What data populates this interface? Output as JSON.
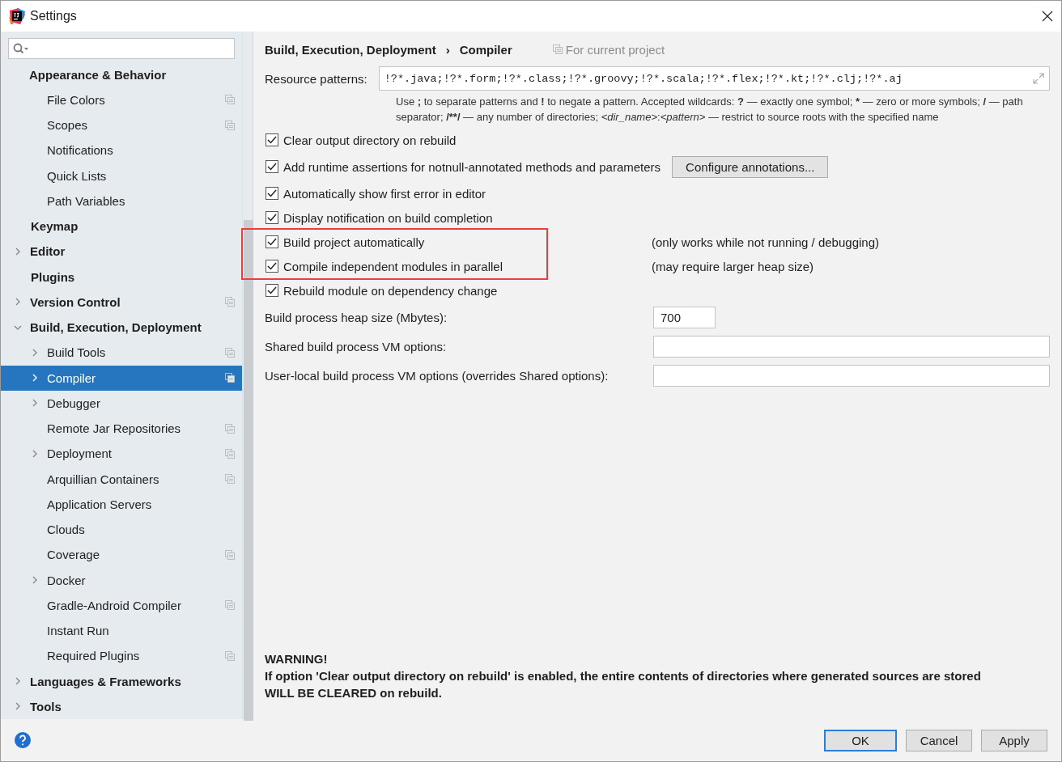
{
  "window": {
    "title": "Settings"
  },
  "sidebar": {
    "items": [
      {
        "label": "Appearance & Behavior",
        "selected": false,
        "project_icon": false,
        "children": [
          {
            "label": "File Colors",
            "selected": false,
            "project_icon": true
          },
          {
            "label": "Scopes",
            "selected": false,
            "project_icon": true
          },
          {
            "label": "Notifications",
            "selected": false,
            "project_icon": false
          },
          {
            "label": "Quick Lists",
            "selected": false,
            "project_icon": false
          },
          {
            "label": "Path Variables",
            "selected": false,
            "project_icon": false
          }
        ]
      },
      {
        "label": "Keymap",
        "selected": false,
        "project_icon": false
      },
      {
        "label": "Editor",
        "selected": false,
        "expanded": false,
        "project_icon": false
      },
      {
        "label": "Plugins",
        "selected": false,
        "project_icon": false
      },
      {
        "label": "Version Control",
        "selected": false,
        "expanded": false,
        "project_icon": true
      },
      {
        "label": "Build, Execution, Deployment",
        "selected": false,
        "expanded": true,
        "project_icon": false,
        "children": [
          {
            "label": "Build Tools",
            "selected": false,
            "expanded": false,
            "project_icon": true
          },
          {
            "label": "Compiler",
            "selected": true,
            "expanded": false,
            "project_icon": true
          },
          {
            "label": "Debugger",
            "selected": false,
            "expanded": false,
            "project_icon": false
          },
          {
            "label": "Remote Jar Repositories",
            "selected": false,
            "project_icon": true
          },
          {
            "label": "Deployment",
            "selected": false,
            "expanded": false,
            "project_icon": true
          },
          {
            "label": "Arquillian Containers",
            "selected": false,
            "project_icon": true
          },
          {
            "label": "Application Servers",
            "selected": false,
            "project_icon": false
          },
          {
            "label": "Clouds",
            "selected": false,
            "project_icon": false
          },
          {
            "label": "Coverage",
            "selected": false,
            "project_icon": true
          },
          {
            "label": "Docker",
            "selected": false,
            "expanded": false,
            "project_icon": false
          },
          {
            "label": "Gradle-Android Compiler",
            "selected": false,
            "project_icon": true
          },
          {
            "label": "Instant Run",
            "selected": false,
            "project_icon": false
          },
          {
            "label": "Required Plugins",
            "selected": false,
            "project_icon": true
          }
        ]
      },
      {
        "label": "Languages & Frameworks",
        "selected": false,
        "expanded": false,
        "project_icon": false
      },
      {
        "label": "Tools",
        "selected": false,
        "expanded": false,
        "project_icon": false
      }
    ]
  },
  "panel": {
    "breadcrumb": [
      "Build, Execution, Deployment",
      "›",
      "Compiler"
    ],
    "scope": "For current project",
    "resource_patterns": {
      "label": "Resource patterns:",
      "value": "!?*.java;!?*.form;!?*.class;!?*.groovy;!?*.scala;!?*.flex;!?*.kt;!?*.clj;!?*.aj"
    },
    "help": [
      {
        "text": "Use ",
        "kind": "text"
      },
      {
        "text": ";",
        "kind": "symbol"
      },
      {
        "text": " to separate patterns and ",
        "kind": "text"
      },
      {
        "text": "!",
        "kind": "symbol"
      },
      {
        "text": " to negate a pattern. Accepted wildcards: ",
        "kind": "text"
      },
      {
        "text": "?",
        "kind": "symbol"
      },
      {
        "text": " — exactly one symbol; ",
        "kind": "text"
      },
      {
        "text": "*",
        "kind": "symbol"
      },
      {
        "text": " — zero or more symbols; ",
        "kind": "text"
      },
      {
        "text": "/",
        "kind": "symbol"
      },
      {
        "text": " — path separator; ",
        "kind": "text"
      },
      {
        "text": "/**/",
        "kind": "symbol"
      },
      {
        "text": " — any number of directories; ",
        "kind": "text"
      },
      {
        "text": "<dir_name>",
        "kind": "template"
      },
      {
        "text": ":",
        "kind": "text"
      },
      {
        "text": "<pattern>",
        "kind": "template"
      },
      {
        "text": " — restrict to source roots with the specified name",
        "kind": "text"
      }
    ],
    "options": [
      {
        "label": "Clear output directory on rebuild",
        "checked": true,
        "highlighted": false
      },
      {
        "label": "Add runtime assertions for notnull-annotated methods and parameters",
        "checked": true,
        "highlighted": false,
        "button": "Configure annotations..."
      },
      {
        "label": "Automatically show first error in editor",
        "checked": true,
        "highlighted": false
      },
      {
        "label": "Display notification on build completion",
        "checked": true,
        "highlighted": false
      },
      {
        "label": "Build project automatically",
        "checked": true,
        "highlighted": true,
        "note": "(only works while not running / debugging)"
      },
      {
        "label": "Compile independent modules in parallel",
        "checked": true,
        "highlighted": true,
        "note": "(may require larger heap size)"
      },
      {
        "label": "Rebuild module on dependency change",
        "checked": true,
        "highlighted": false
      }
    ],
    "fields": [
      {
        "label": "Build process heap size (Mbytes):",
        "value": "700",
        "kind": "short"
      },
      {
        "label": "Shared build process VM options:",
        "kind": "wide"
      },
      {
        "label": "User-local build process VM options (overrides Shared options):",
        "kind": "wide"
      }
    ],
    "warning": [
      "WARNING!",
      "If option 'Clear output directory on rebuild' is enabled, the entire contents of directories where generated sources are stored",
      "WILL BE CLEARED on rebuild."
    ]
  },
  "buttons": [
    {
      "label": "OK",
      "default": true
    },
    {
      "label": "Cancel",
      "default": false
    },
    {
      "label": "Apply",
      "default": false
    }
  ]
}
